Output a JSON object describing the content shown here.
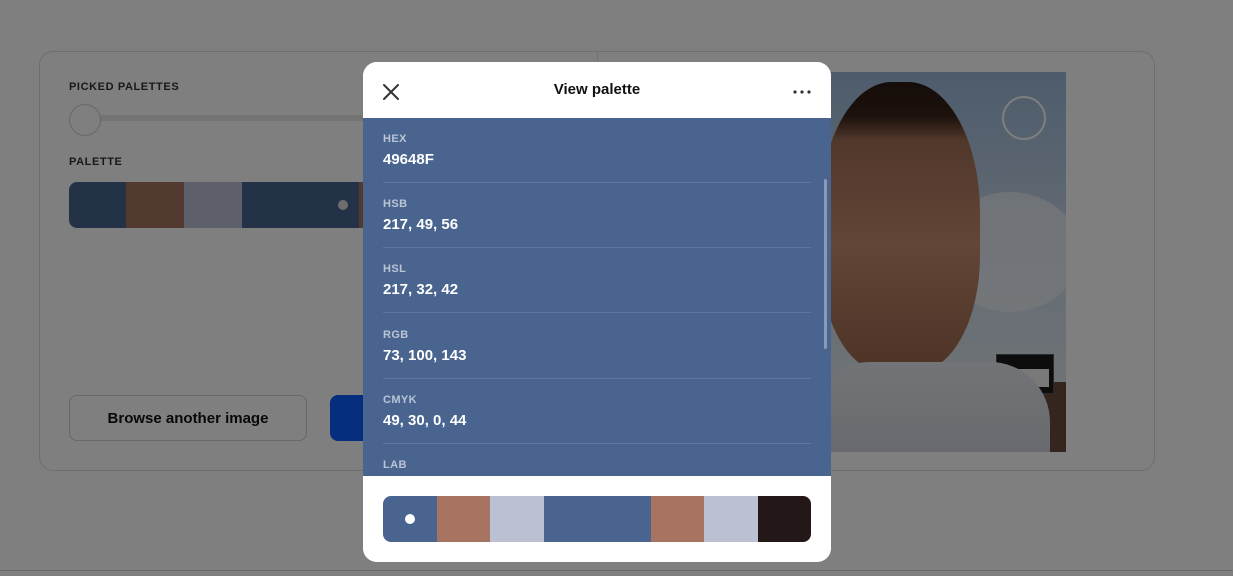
{
  "background": {
    "picked_palettes_label": "PICKED PALETTES",
    "palette_label": "PALETTE",
    "browse_button_label": "Browse another image",
    "small_palette": [
      {
        "color": "#49648F",
        "flex": 57
      },
      {
        "color": "#A67460",
        "flex": 58
      },
      {
        "color": "#BBC1D3",
        "flex": 58
      },
      {
        "color": "#49648F",
        "flex": 117,
        "selected": true
      },
      {
        "color": "#A67460",
        "flex": 58
      },
      {
        "color": "#BBC1D3",
        "flex": 58
      },
      {
        "color": "#231717",
        "flex": 64
      }
    ],
    "primary_button_color": "#0a5cff"
  },
  "modal": {
    "title": "View palette",
    "close_icon": "close-icon",
    "more_icon": "more-horizontal-icon",
    "panel_color": "#49648F",
    "values": [
      {
        "label": "HEX",
        "value": "49648F"
      },
      {
        "label": "HSB",
        "value": "217, 49, 56"
      },
      {
        "label": "HSL",
        "value": "217, 32, 42"
      },
      {
        "label": "RGB",
        "value": "73, 100, 143"
      },
      {
        "label": "CMYK",
        "value": "49, 30, 0, 44"
      },
      {
        "label": "LAB",
        "value": ""
      }
    ],
    "palette": [
      {
        "color": "#49648F",
        "flex": 54,
        "selected": true
      },
      {
        "color": "#A67460",
        "flex": 53
      },
      {
        "color": "#BBC1D3",
        "flex": 54
      },
      {
        "color": "#49648F",
        "flex": 107
      },
      {
        "color": "#A67460",
        "flex": 53
      },
      {
        "color": "#BBC1D3",
        "flex": 54
      },
      {
        "color": "#231717",
        "flex": 53
      }
    ]
  }
}
